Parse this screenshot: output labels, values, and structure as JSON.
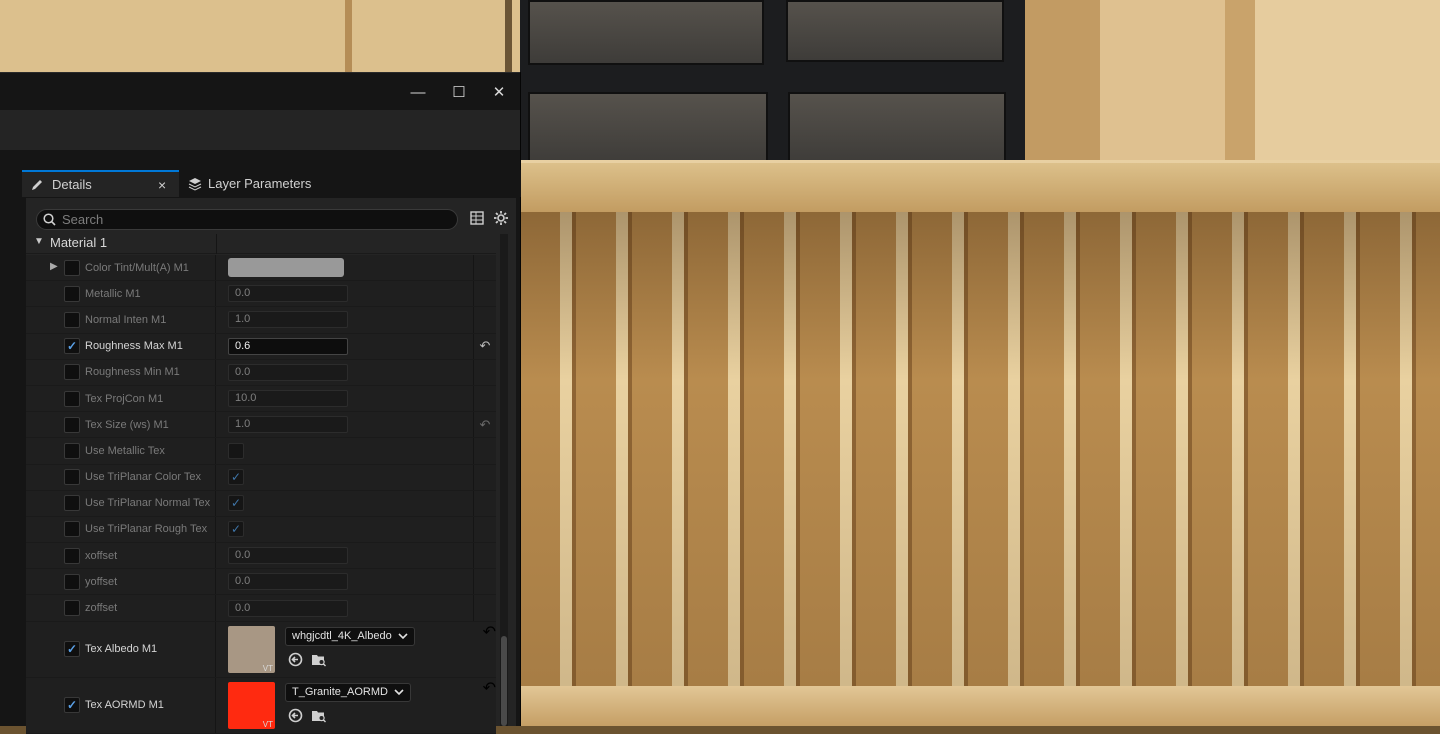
{
  "window": {
    "controls": {
      "minimize": "—",
      "maximize": "☐",
      "close": "✕"
    }
  },
  "tabs": [
    {
      "label": "Details",
      "close": "×"
    },
    {
      "label": "Layer Parameters"
    }
  ],
  "search": {
    "placeholder": "Search"
  },
  "category": {
    "label": "Material 1",
    "arrow": "▼"
  },
  "rows": [
    {
      "label": "Color Tint/Mult(A) M1",
      "checked": false,
      "type": "color",
      "color": "#999999",
      "expander": "▶"
    },
    {
      "label": "Metallic M1",
      "checked": false,
      "type": "number",
      "value": "0.0"
    },
    {
      "label": "Normal Inten M1",
      "checked": false,
      "type": "number",
      "value": "1.0"
    },
    {
      "label": "Roughness Max M1",
      "checked": true,
      "type": "number",
      "value": "0.6",
      "reset": "↶"
    },
    {
      "label": "Roughness Min M1",
      "checked": false,
      "type": "number",
      "value": "0.0"
    },
    {
      "label": "Tex ProjCon M1",
      "checked": false,
      "type": "number",
      "value": "10.0"
    },
    {
      "label": "Tex Size (ws) M1",
      "checked": false,
      "type": "number",
      "value": "1.0",
      "reset": "↶"
    },
    {
      "label": "Use Metallic Tex",
      "checked": false,
      "type": "bool",
      "value": ""
    },
    {
      "label": "Use TriPlanar Color Tex",
      "checked": false,
      "type": "bool",
      "value": "✓"
    },
    {
      "label": "Use TriPlanar Normal Tex",
      "checked": false,
      "type": "bool",
      "value": "✓"
    },
    {
      "label": "Use TriPlanar Rough Tex",
      "checked": false,
      "type": "bool",
      "value": "✓"
    },
    {
      "label": "xoffset",
      "checked": false,
      "type": "number",
      "value": "0.0"
    },
    {
      "label": "yoffset",
      "checked": false,
      "type": "number",
      "value": "0.0"
    },
    {
      "label": "zoffset",
      "checked": false,
      "type": "number",
      "value": "0.0"
    }
  ],
  "texture_rows": [
    {
      "label": "Tex Albedo M1",
      "checked": true,
      "asset": "whgjcdtl_4K_Albedo",
      "thumb_color": "#a89784",
      "badge": "VT",
      "reset": "↶"
    },
    {
      "label": "Tex AORMD M1",
      "checked": true,
      "asset": "T_Granite_AORMD",
      "thumb_color": "#ff2a10",
      "badge": "VT",
      "reset": "↶"
    }
  ],
  "icons": {
    "check": "✓",
    "dropdown": "⌄",
    "use_selected": "⇦",
    "browse": "🔍"
  }
}
